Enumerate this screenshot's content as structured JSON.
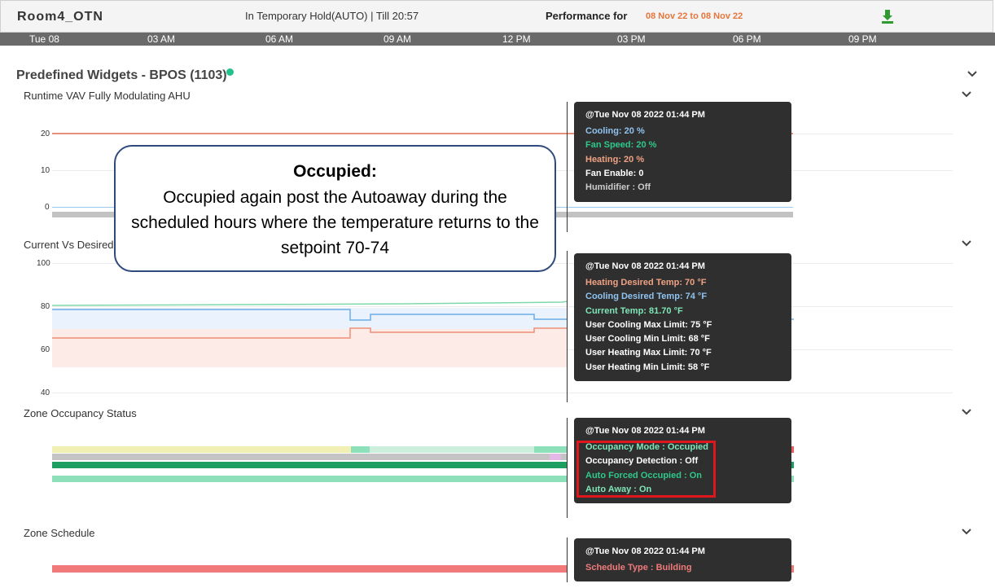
{
  "header": {
    "room": "Room4_OTN",
    "status": "In Temporary Hold(AUTO) | Till 20:57",
    "performance_label": "Performance for",
    "date_range": "08 Nov 22 to 08 Nov 22",
    "download_icon": "download-icon"
  },
  "timeline": [
    "Tue 08",
    "03 AM",
    "06 AM",
    "09 AM",
    "12 PM",
    "03 PM",
    "06 PM",
    "09 PM"
  ],
  "section": {
    "title": "Predefined Widgets - BPOS (1103)",
    "status_color": "#23c28a"
  },
  "widgets": {
    "runtime": {
      "title": "Runtime VAV Fully Modulating AHU",
      "y_ticks": [
        "20",
        "10",
        "0"
      ],
      "tooltip": {
        "timestamp": "@Tue Nov 08 2022 01:44 PM",
        "lines": [
          "Cooling: 20 %",
          "Fan Speed: 20 %",
          "Heating: 20 %",
          "Fan Enable: 0",
          "Humidifier : Off"
        ],
        "colors": [
          "#8fc3f0",
          "#2fc88b",
          "#f0a184",
          "#ffffff",
          "#cccccc"
        ]
      }
    },
    "temp": {
      "title": "Current Vs Desired",
      "y_ticks": [
        "100",
        "80",
        "60",
        "40"
      ],
      "tooltip": {
        "timestamp": "@Tue Nov 08 2022 01:44 PM",
        "lines": [
          "Heating Desired Temp: 70 °F",
          "Cooling Desired Temp: 74 °F",
          "Current Temp: 81.70 °F",
          "User Cooling Max Limit: 75 °F",
          "User Cooling Min Limit: 68 °F",
          "User Heating Max Limit: 70 °F",
          "User Heating Min Limit: 58 °F"
        ],
        "colors": [
          "#f0a184",
          "#8fc3f0",
          "#7fe6b8",
          "#ffffff",
          "#ffffff",
          "#ffffff",
          "#ffffff"
        ]
      }
    },
    "occupancy": {
      "title": "Zone Occupancy Status",
      "tooltip": {
        "timestamp": "@Tue Nov 08 2022 01:44 PM",
        "lines": [
          "Occupancy Mode : Occupied",
          "Occupancy Detection : Off",
          "Auto Forced Occupied : On",
          "Auto Away : On"
        ],
        "colors": [
          "#7fe6b8",
          "#ffffff",
          "#2fc88b",
          "#7fe6b8"
        ]
      }
    },
    "schedule": {
      "title": "Zone Schedule",
      "tooltip": {
        "timestamp": "@Tue Nov 08 2022 01:44 PM",
        "lines": [
          "Schedule Type : Building"
        ],
        "colors": [
          "#f07a7a"
        ]
      }
    }
  },
  "callout": {
    "heading": "Occupied:",
    "body": "Occupied again post the Autoaway during the scheduled hours where the temperature returns to the setpoint 70-74"
  },
  "colors": {
    "accent_orange": "#e8763c",
    "green": "#23c28a",
    "highlight_red": "#e0161d"
  }
}
